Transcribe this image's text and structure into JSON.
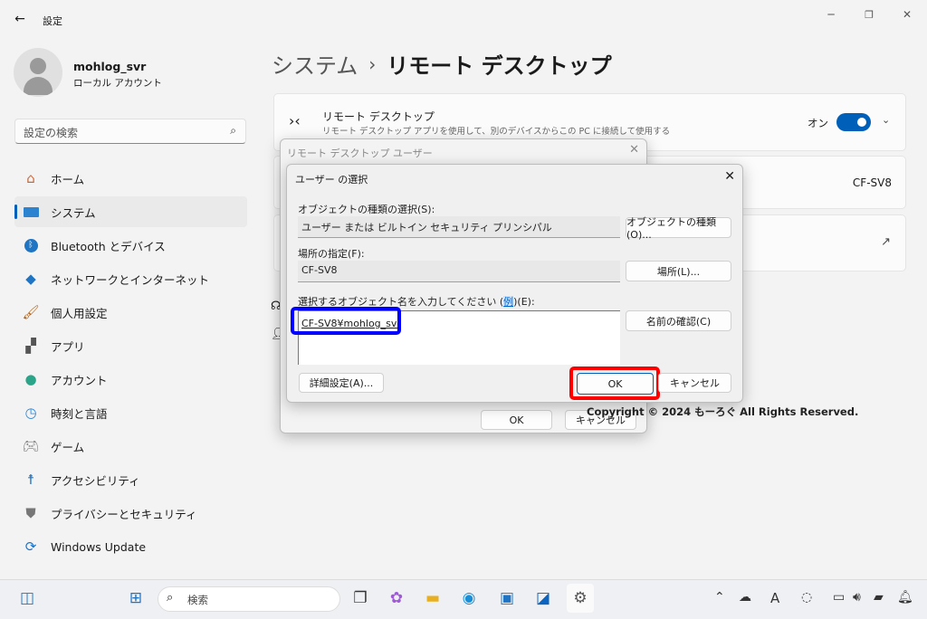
{
  "window": {
    "title": "設定"
  },
  "profile": {
    "name": "mohlog_svr",
    "type": "ローカル アカウント"
  },
  "search": {
    "placeholder": "設定の検索"
  },
  "nav": [
    {
      "label": "ホーム",
      "icon": "home-icon"
    },
    {
      "label": "システム",
      "icon": "monitor-icon"
    },
    {
      "label": "Bluetooth とデバイス",
      "icon": "bluetooth-icon"
    },
    {
      "label": "ネットワークとインターネット",
      "icon": "wifi-icon"
    },
    {
      "label": "個人用設定",
      "icon": "brush-icon"
    },
    {
      "label": "アプリ",
      "icon": "apps-icon"
    },
    {
      "label": "アカウント",
      "icon": "account-icon"
    },
    {
      "label": "時刻と言語",
      "icon": "clock-globe-icon"
    },
    {
      "label": "ゲーム",
      "icon": "gamepad-icon"
    },
    {
      "label": "アクセシビリティ",
      "icon": "accessibility-icon"
    },
    {
      "label": "プライバシーとセキュリティ",
      "icon": "shield-icon"
    },
    {
      "label": "Windows Update",
      "icon": "update-icon"
    }
  ],
  "breadcrumb": {
    "parent": "システム",
    "separator": "›",
    "current": "リモート デスクトップ"
  },
  "rd_card": {
    "title": "リモート デスクトップ",
    "desc": "リモート デスクトップ アプリを使用して、別のデバイスからこの PC に接続して使用する",
    "toggle_label": "オン",
    "toggle_on": true
  },
  "pc_card": {
    "value": "CF-SV8"
  },
  "back_dialog": {
    "title": "リモート デスクトップ ユーザー",
    "ok": "OK",
    "cancel": "キャンセル"
  },
  "dialog": {
    "title": "ユーザー の選択",
    "obj_type_label": "オブジェクトの種類の選択(S):",
    "obj_type_value": "ユーザー または ビルトイン セキュリティ プリンシパル",
    "obj_type_button": "オブジェクトの種類(O)...",
    "location_label": "場所の指定(F):",
    "location_value": "CF-SV8",
    "location_button": "場所(L)...",
    "name_label_pre": "選択するオブジェクト名を入力してください (",
    "name_label_link": "例",
    "name_label_post": ")(E):",
    "name_value": "CF-SV8¥mohlog_svr",
    "check_names": "名前の確認(C)",
    "advanced": "詳細設定(A)...",
    "ok": "OK",
    "cancel": "キャンセル"
  },
  "copyright": "Copyright © 2024 もーろぐ All Rights Reserved.",
  "taskbar": {
    "search_placeholder": "検索",
    "ime": "A"
  },
  "colors": {
    "accent": "#005fb8",
    "highlight_blue": "#0000ff",
    "highlight_red": "#ff0000"
  }
}
